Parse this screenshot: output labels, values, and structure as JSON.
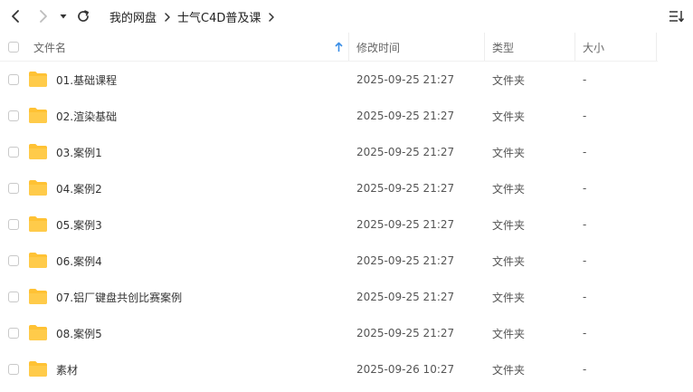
{
  "breadcrumb": {
    "root": "我的网盘",
    "current": "士气C4D普及课"
  },
  "icons": {
    "back": "chevron-left-icon",
    "forward": "chevron-right-icon",
    "history": "caret-down-icon",
    "refresh": "refresh-icon",
    "view": "sort-list-icon",
    "folder": "folder-icon"
  },
  "colors": {
    "folder": "#FFC234",
    "sort_arrow": "#3a8ee6"
  },
  "columns": {
    "name": "文件名",
    "modified": "修改时间",
    "type": "类型",
    "size": "大小"
  },
  "files": [
    {
      "name": "01.基础课程",
      "modified": "2025-09-25 21:27",
      "type": "文件夹",
      "size": "-"
    },
    {
      "name": "02.渲染基础",
      "modified": "2025-09-25 21:27",
      "type": "文件夹",
      "size": "-"
    },
    {
      "name": "03.案例1",
      "modified": "2025-09-25 21:27",
      "type": "文件夹",
      "size": "-"
    },
    {
      "name": "04.案例2",
      "modified": "2025-09-25 21:27",
      "type": "文件夹",
      "size": "-"
    },
    {
      "name": "05.案例3",
      "modified": "2025-09-25 21:27",
      "type": "文件夹",
      "size": "-"
    },
    {
      "name": "06.案例4",
      "modified": "2025-09-25 21:27",
      "type": "文件夹",
      "size": "-"
    },
    {
      "name": "07.铝厂键盘共创比赛案例",
      "modified": "2025-09-25 21:27",
      "type": "文件夹",
      "size": "-"
    },
    {
      "name": "08.案例5",
      "modified": "2025-09-25 21:27",
      "type": "文件夹",
      "size": "-"
    },
    {
      "name": "素材",
      "modified": "2025-09-26 10:27",
      "type": "文件夹",
      "size": "-"
    }
  ]
}
